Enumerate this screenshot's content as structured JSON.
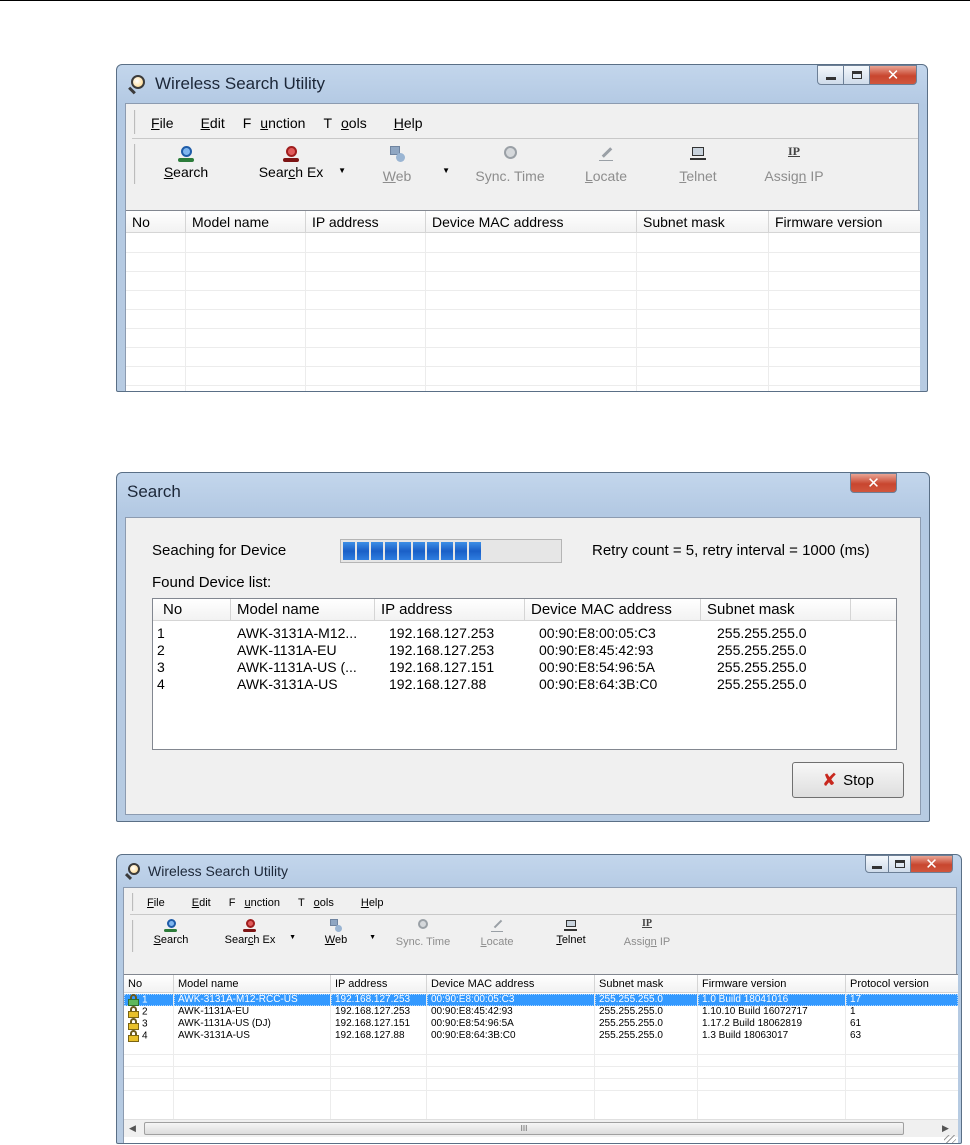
{
  "win1": {
    "title": "Wireless Search Utility",
    "menu": [
      {
        "pre": "",
        "u": "F",
        "post": "ile"
      },
      {
        "pre": "",
        "u": "E",
        "post": "dit"
      },
      {
        "pre": "F",
        "u": "u",
        "post": "nction"
      },
      {
        "pre": "T",
        "u": "o",
        "post": "ols"
      },
      {
        "pre": "",
        "u": "H",
        "post": "elp"
      }
    ],
    "toolbar": {
      "search": {
        "pre": "",
        "u": "S",
        "post": "earch"
      },
      "search_ex": {
        "pre": "Sear",
        "u": "c",
        "post": "h Ex"
      },
      "web": {
        "pre": "",
        "u": "W",
        "post": "eb"
      },
      "sync_time": {
        "pre": "Sync. Time",
        "u": "",
        "post": ""
      },
      "locate": {
        "pre": "",
        "u": "L",
        "post": "ocate"
      },
      "telnet": {
        "pre": "",
        "u": "T",
        "post": "elnet"
      },
      "assign_ip": {
        "pre": "Assig",
        "u": "n",
        "post": " IP"
      },
      "ip_glyph": "IP"
    },
    "columns": [
      "No",
      "Model name",
      "IP address",
      "Device MAC address",
      "Subnet mask",
      "Firmware version"
    ]
  },
  "dialog": {
    "title": "Search",
    "searching_label": "Seaching for Device",
    "retry_text": "Retry count = 5, retry interval = 1000 (ms)",
    "progress": 0.64,
    "found_label": "Found Device list:",
    "columns": [
      "No",
      "Model name",
      "IP address",
      "Device MAC address",
      "Subnet mask"
    ],
    "rows": [
      [
        "1",
        "AWK-3131A-M12...",
        "192.168.127.253",
        "00:90:E8:00:05:C3",
        "255.255.255.0"
      ],
      [
        "2",
        "AWK-1131A-EU",
        "192.168.127.253",
        "00:90:E8:45:42:93",
        "255.255.255.0"
      ],
      [
        "3",
        "AWK-1131A-US (...",
        "192.168.127.151",
        "00:90:E8:54:96:5A",
        "255.255.255.0"
      ],
      [
        "4",
        "AWK-3131A-US",
        "192.168.127.88",
        "00:90:E8:64:3B:C0",
        "255.255.255.0"
      ]
    ],
    "stop_label": "Stop"
  },
  "win3": {
    "title": "Wireless Search Utility",
    "columns": [
      "No",
      "Model name",
      "IP address",
      "Device MAC address",
      "Subnet mask",
      "Firmware version",
      "Protocol version"
    ],
    "rows": [
      [
        "1",
        "AWK-3131A-M12-RCC-US",
        "192.168.127.253",
        "00:90:E8:00:05:C3",
        "255.255.255.0",
        "1.0 Build 18041016",
        "17"
      ],
      [
        "2",
        "AWK-1131A-EU",
        "192.168.127.253",
        "00:90:E8:45:42:93",
        "255.255.255.0",
        "1.10.10 Build 16072717",
        "1"
      ],
      [
        "3",
        "AWK-1131A-US (DJ)",
        "192.168.127.151",
        "00:90:E8:54:96:5A",
        "255.255.255.0",
        "1.17.2 Build 18062819",
        "61"
      ],
      [
        "4",
        "AWK-3131A-US",
        "192.168.127.88",
        "00:90:E8:64:3B:C0",
        "255.255.255.0",
        "1.3 Build 18063017",
        "63"
      ]
    ],
    "selected_row": 0,
    "scroll_thumb_glyph": "III"
  },
  "colors": {
    "selection": "#3399ff",
    "progress_fill": "#1a5fc7",
    "close_button": "#c8462f"
  },
  "icons": {
    "app": "magnifier-icon",
    "search": "search-icon",
    "search_ex": "search-ex-icon",
    "web": "web-icon",
    "sync": "sync-time-icon",
    "locate": "locate-icon",
    "telnet": "telnet-icon",
    "assign_ip": "assign-ip-icon",
    "lock": "lock-icon",
    "stop": "x-icon"
  }
}
